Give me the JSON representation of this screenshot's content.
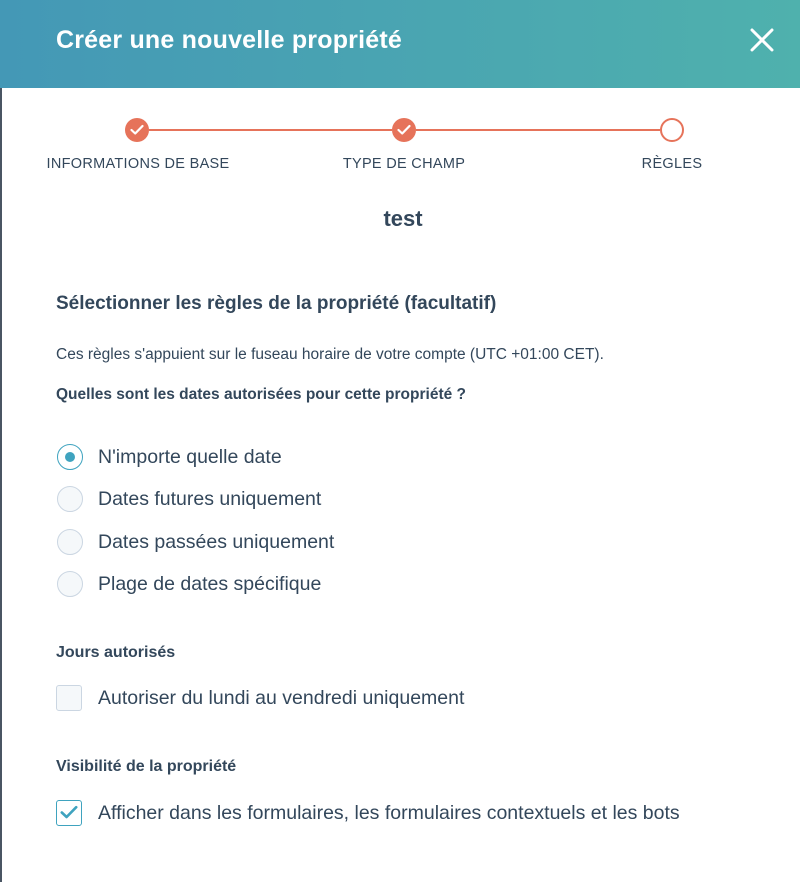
{
  "header": {
    "title": "Créer une nouvelle propriété"
  },
  "stepper": {
    "steps": [
      {
        "label": "INFORMATIONS DE BASE",
        "status": "completed"
      },
      {
        "label": "TYPE DE CHAMP",
        "status": "completed"
      },
      {
        "label": "RÈGLES",
        "status": "current"
      }
    ]
  },
  "property": {
    "name": "test"
  },
  "rules": {
    "heading": "Sélectionner les règles de la propriété (facultatif)",
    "timezone_note": "Ces règles s'appuient sur le fuseau horaire de votre compte (UTC +01:00 CET).",
    "question": "Quelles sont les dates autorisées pour cette propriété ?",
    "date_options": [
      {
        "label": "N'importe quelle date",
        "checked": true
      },
      {
        "label": "Dates futures uniquement",
        "checked": false
      },
      {
        "label": "Dates passées uniquement",
        "checked": false
      },
      {
        "label": "Plage de dates spécifique",
        "checked": false
      }
    ]
  },
  "allowed_days": {
    "heading": "Jours autorisés",
    "checkbox_label": "Autoriser du lundi au vendredi uniquement",
    "checked": false
  },
  "visibility": {
    "heading": "Visibilité de la propriété",
    "checkbox_label": "Afficher dans les formulaires, les formulaires contextuels et les bots",
    "checked": true
  },
  "colors": {
    "header_gradient_start": "#4498b6",
    "header_gradient_end": "#4fb1ad",
    "step_accent": "#e6735a",
    "control_accent": "#3fa3bf",
    "text": "#33475b"
  },
  "icons": {
    "close": "close-icon",
    "step_done": "checkmark-icon",
    "checkbox_checked": "checkmark-icon"
  }
}
